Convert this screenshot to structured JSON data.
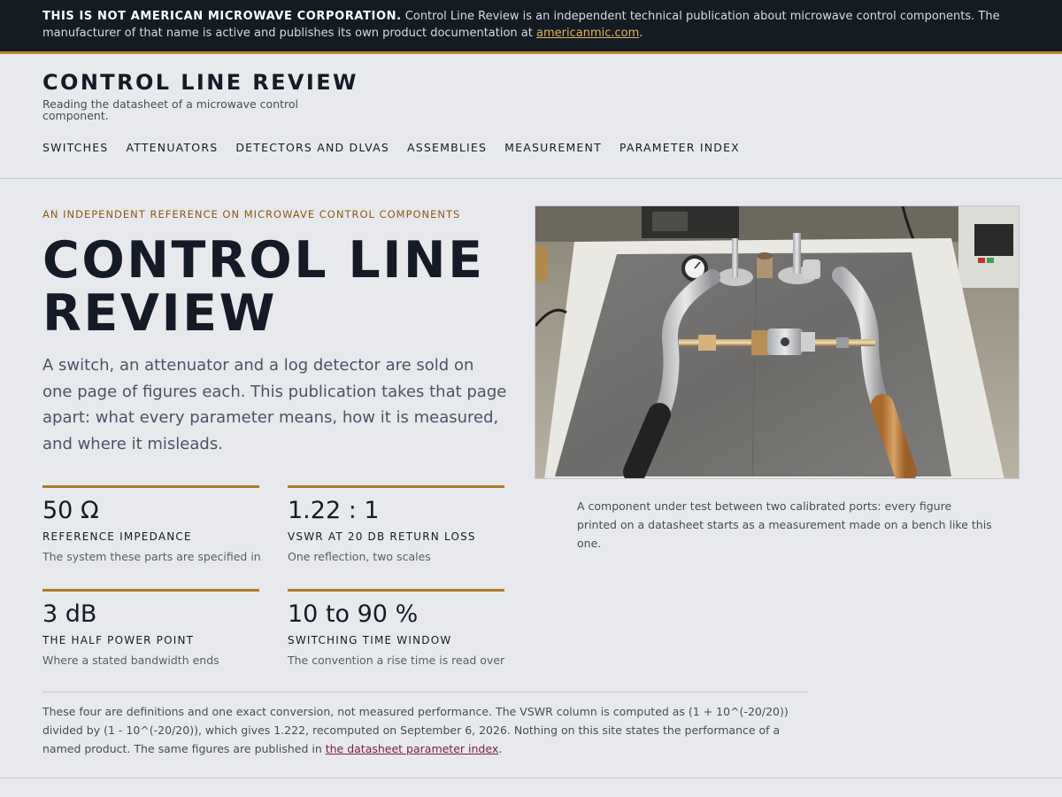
{
  "notice": {
    "strong": "THIS IS NOT AMERICAN MICROWAVE CORPORATION.",
    "text": " Control Line Review is an independent technical publication about microwave control components. The manufacturer of that name is active and publishes its own product documentation at ",
    "link_text": "americanmic.com",
    "tail": "."
  },
  "site": {
    "title": "CONTROL LINE REVIEW",
    "tagline": "Reading the datasheet of a microwave control component."
  },
  "nav": {
    "items": [
      "SWITCHES",
      "ATTENUATORS",
      "DETECTORS AND DLVAS",
      "ASSEMBLIES",
      "MEASUREMENT",
      "PARAMETER INDEX"
    ]
  },
  "hero": {
    "kicker": "AN INDEPENDENT REFERENCE ON MICROWAVE CONTROL COMPONENTS",
    "title": "CONTROL LINE REVIEW",
    "lede": "A switch, an attenuator and a log detector are sold on one page of figures each. This publication takes that page apart: what every parameter means, how it is measured, and where it misleads."
  },
  "stats": [
    {
      "value": "50 Ω",
      "label": "REFERENCE IMPEDANCE",
      "note": "The system these parts are specified in"
    },
    {
      "value": "1.22 : 1",
      "label": "VSWR AT 20 DB RETURN LOSS",
      "note": "One reflection, two scales"
    },
    {
      "value": "3 dB",
      "label": "THE HALF POWER POINT",
      "note": "Where a stated bandwidth ends"
    },
    {
      "value": "10 to 90 %",
      "label": "SWITCHING TIME WINDOW",
      "note": "The convention a rise time is read over"
    }
  ],
  "footnote": {
    "text": "These four are definitions and one exact conversion, not measured performance. The VSWR column is computed as (1 + 10^(-20/20)) divided by (1 - 10^(-20/20)), which gives 1.222, recomputed on September 6, 2026. Nothing on this site states the performance of a named product. The same figures are published in ",
    "link_text": "the datasheet parameter index",
    "tail": "."
  },
  "photo": {
    "caption": "A component under test between two calibrated ports: every figure printed on a datasheet starts as a measurement made on a bench like this one."
  },
  "colors": {
    "banner_bg": "#151b23",
    "accent": "#b07a26",
    "page_bg": "#e8e9ed",
    "link": "#7a1f35"
  }
}
